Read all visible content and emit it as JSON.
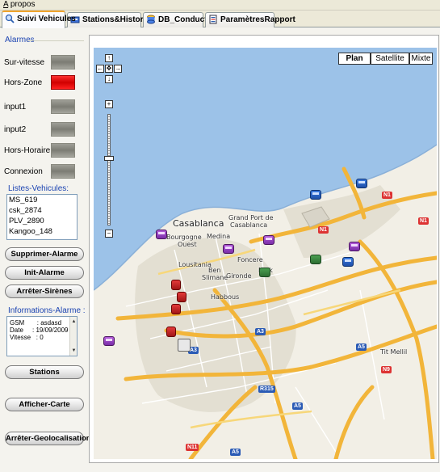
{
  "menu": {
    "apropos": "A propos"
  },
  "tabs": [
    {
      "label": "Suivi Vehicules",
      "icon": "search-icon",
      "active": true
    },
    {
      "label": "Stations&Historique",
      "icon": "station-icon",
      "active": false
    },
    {
      "label": "DB_Conducteurs",
      "icon": "database-icon",
      "active": false
    },
    {
      "label": "ParamètresRapport",
      "icon": "report-icon",
      "active": false
    }
  ],
  "alarms": {
    "group_title": "Alarmes",
    "items": [
      {
        "label": "Sur-vitesse",
        "state": "off"
      },
      {
        "label": "Hors-Zone",
        "state": "on"
      },
      {
        "label": "input1",
        "state": "off"
      },
      {
        "label": "input2",
        "state": "off"
      },
      {
        "label": "Hors-Horaire",
        "state": "off"
      },
      {
        "label": "Connexion",
        "state": "off"
      }
    ]
  },
  "vehicles": {
    "title": "Listes-Vehicules:",
    "items": [
      "MS_619",
      "csk_2874",
      "PLV_2890",
      "Kangoo_148"
    ]
  },
  "buttons": {
    "supprimer": "Supprimer-Alarme",
    "init": "Init-Alarme",
    "arreter_sirenes": "Arrêter-Sirènes",
    "stations": "Stations",
    "afficher_carte": "Afficher-Carte",
    "arreter_geo": "Arrêter-Geolocalisation"
  },
  "info_alarme": {
    "title": "Informations-Alarme :",
    "lines": [
      "GSM       : asdasd",
      "Date     : 19/09/2009",
      "Vitesse   : 0"
    ]
  },
  "map": {
    "types": [
      "Plan",
      "Satellite",
      "Mixte"
    ],
    "selected_type": "Plan",
    "labels": {
      "casablanca": "Casablanca",
      "grand_port": "Grand Port de",
      "grand_port2": "Casablanca",
      "bourgogne": "Bourgogne",
      "ouest": "Ouest",
      "medina": "Medina",
      "lousitania": "Lousitania",
      "foncere": "Foncere",
      "ben": "Ben",
      "msik": "Msik",
      "gironde": "Gironde",
      "slimane": "Slimane",
      "habbous": "Habbous",
      "tit_mellil": "Tit Mellil"
    },
    "shields": [
      "N1",
      "N1",
      "N1",
      "N9",
      "A3",
      "A3",
      "A5",
      "A5",
      "R315",
      "N11",
      "N9",
      "A5",
      "A5"
    ]
  },
  "colors": {
    "led_on": "#e00000",
    "accent": "#1c44b2",
    "tab_highlight": "#f0a42c",
    "water": "#9cc2e8",
    "land": "#f2efe6",
    "urban": "#e3dfd2",
    "highway": "#f2b53a"
  }
}
